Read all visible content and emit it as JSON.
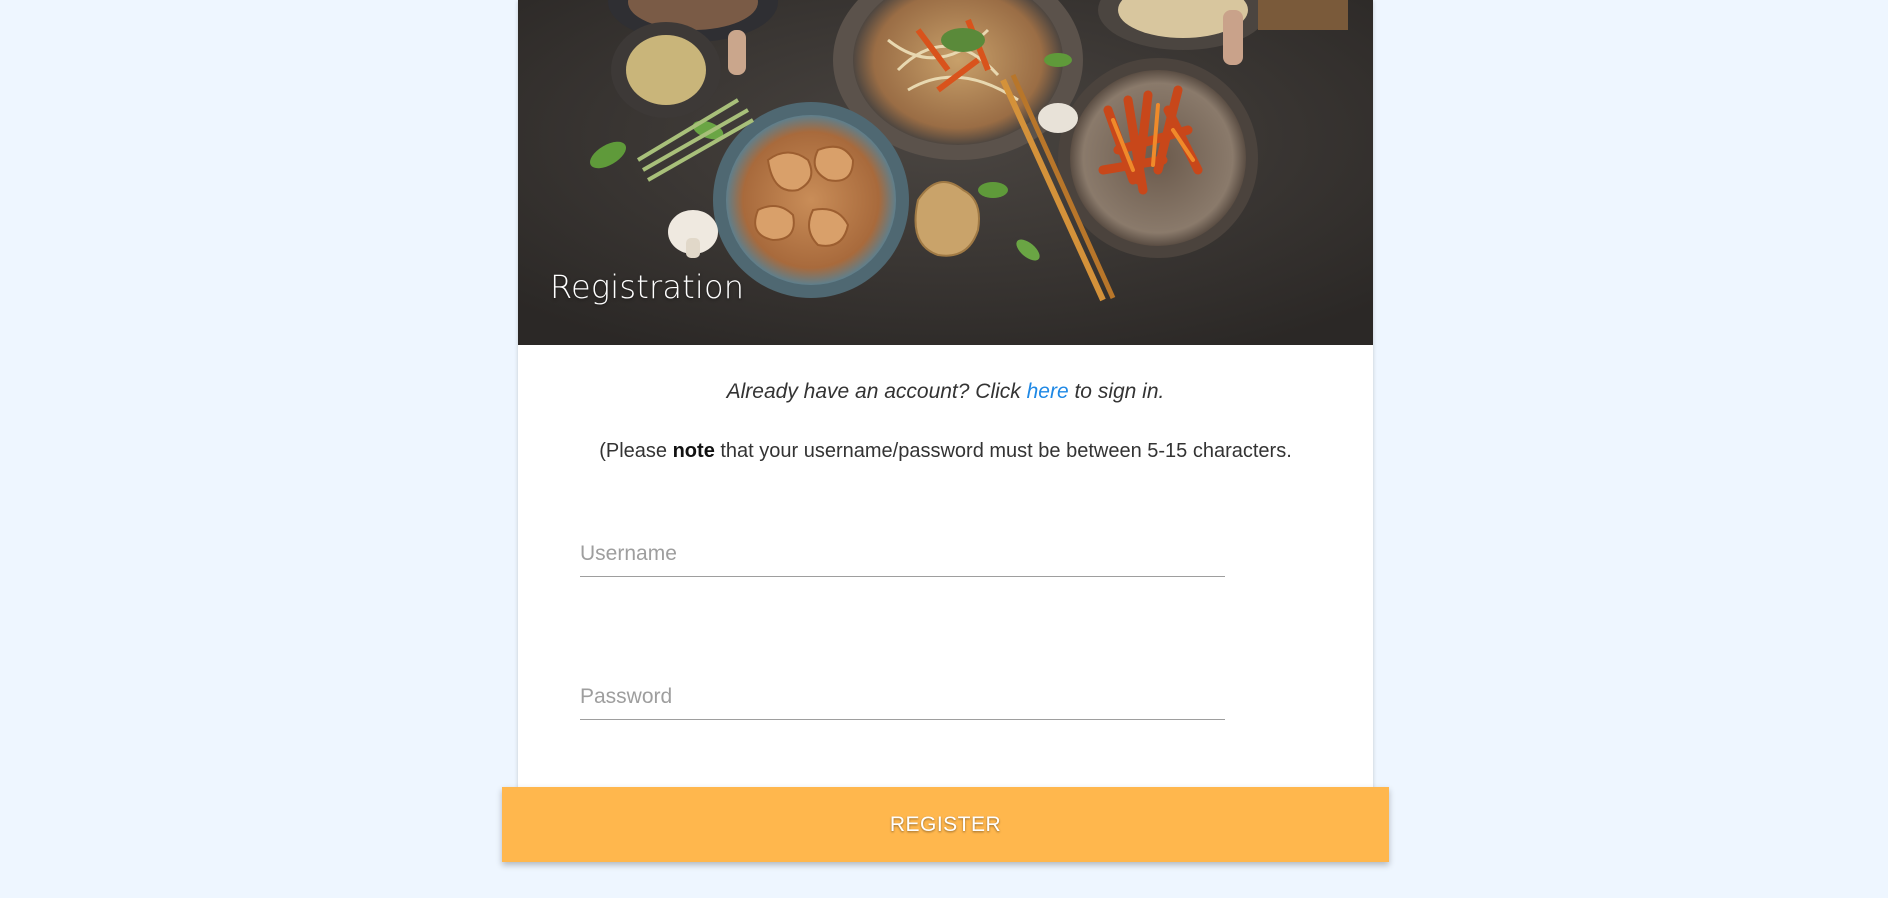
{
  "hero": {
    "title": "Registration",
    "image": "food-bowls-photo"
  },
  "signin": {
    "prefix": "Already have an account? Click ",
    "link_label": "here",
    "suffix": " to sign in."
  },
  "note": {
    "prefix": "(Please ",
    "bold": "note",
    "suffix": " that your username/password must be between 5-15 characters."
  },
  "form": {
    "username_placeholder": "Username",
    "password_placeholder": "Password",
    "register_label": "REGISTER"
  },
  "colors": {
    "page_background": "#eef6ff",
    "link": "#1e88e5",
    "button": "#ffb74d"
  }
}
